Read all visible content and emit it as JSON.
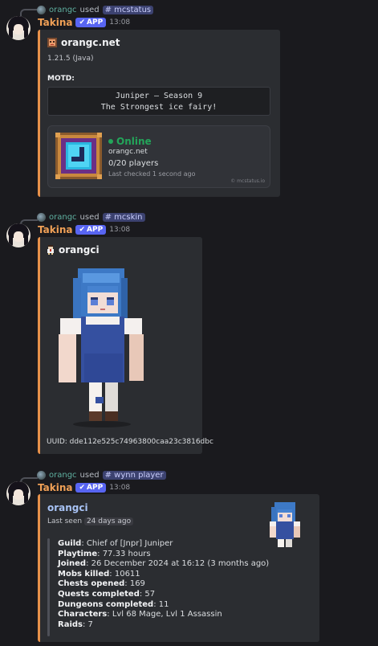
{
  "messages": [
    {
      "reply": {
        "user": "orangc",
        "verb": "used",
        "command": "# mcstatus"
      },
      "author": "Takina",
      "tag": "APP",
      "time": "13:08",
      "embed": {
        "server_name": "orangc.net",
        "version": "1.21.5 (Java)",
        "motd_label": "MOTD:",
        "motd_line1": "Juniper — Season 9",
        "motd_line2": "The Strongest ice fairy!",
        "status": "Online",
        "address": "orangc.net",
        "players": "0/20 players",
        "last_checked": "Last checked 1 second ago",
        "watermark": "© mcstatus.io"
      }
    },
    {
      "reply": {
        "user": "orangc",
        "verb": "used",
        "command": "# mcskin"
      },
      "author": "Takina",
      "tag": "APP",
      "time": "13:08",
      "embed": {
        "player": "orangci",
        "uuid": "UUID: dde112e525c74963800caa23c3816dbc"
      }
    },
    {
      "reply": {
        "user": "orangc",
        "verb": "used",
        "command": "# wynn player"
      },
      "author": "Takina",
      "tag": "APP",
      "time": "13:08",
      "embed": {
        "player": "orangci",
        "last_seen_label": "Last seen",
        "last_seen_value": "24 days ago",
        "stats": [
          {
            "k": "Guild",
            "v": ": Chief of [Jnpr] Juniper"
          },
          {
            "k": "Playtime",
            "v": ": 77.33 hours"
          },
          {
            "k": "Joined",
            "v": ": 26 December 2024 at 16:12 (3 months ago)"
          },
          {
            "k": "Mobs killed",
            "v": ": 10611"
          },
          {
            "k": "Chests opened",
            "v": ": 169"
          },
          {
            "k": "Quests completed",
            "v": ": 57"
          },
          {
            "k": "Dungeons completed",
            "v": ": 11"
          },
          {
            "k": "Characters",
            "v": ": Lvl 68 Mage, Lvl 1 Assassin"
          },
          {
            "k": "Raids",
            "v": ": 7"
          }
        ]
      }
    }
  ],
  "colors": {
    "accent": "#e8914a",
    "online": "#23a55a",
    "author": "#f0a056",
    "app_tag": "#5865f2"
  }
}
